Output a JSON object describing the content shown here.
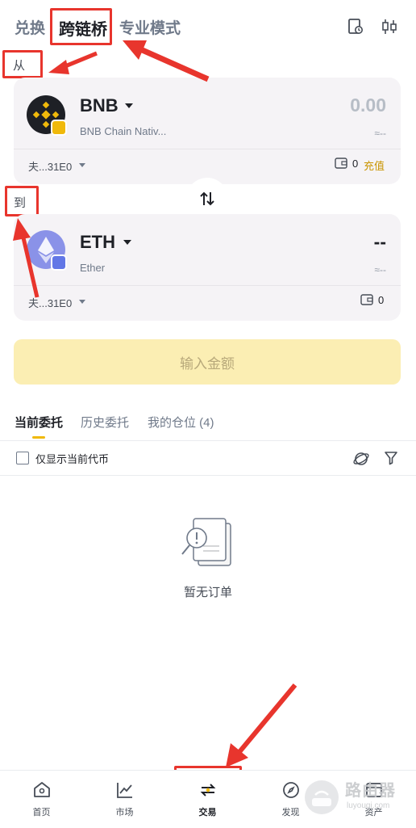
{
  "top_tabs": {
    "swap": "兑换",
    "bridge": "跨链桥",
    "pro": "专业模式"
  },
  "labels": {
    "from": "从",
    "to": "到"
  },
  "from_card": {
    "symbol": "BNB",
    "name": "BNB Chain Nativ...",
    "amount": "0.00",
    "approx": "≈--",
    "network": "夫...31E0",
    "balance": "0",
    "deposit": "充值"
  },
  "to_card": {
    "symbol": "ETH",
    "name": "Ether",
    "amount": "--",
    "approx": "≈--",
    "network": "夫...31E0",
    "balance": "0"
  },
  "primary_button": "输入金额",
  "order_tabs": {
    "current": "当前委托",
    "history": "历史委托",
    "positions": "我的仓位 (4)"
  },
  "filter": {
    "only_current": "仅显示当前代币"
  },
  "empty_state": "暂无订单",
  "bottom_nav": {
    "home": "首页",
    "market": "市场",
    "trade": "交易",
    "discover": "发现",
    "assets": "资产"
  },
  "watermark": {
    "title": "路由器",
    "subtitle": "luyouqi.com"
  },
  "colors": {
    "accent_yellow": "#f0b90b",
    "annotation_red": "#e8352d",
    "button_disabled": "#fbeeb3",
    "card_bg": "#f5f3f6"
  }
}
